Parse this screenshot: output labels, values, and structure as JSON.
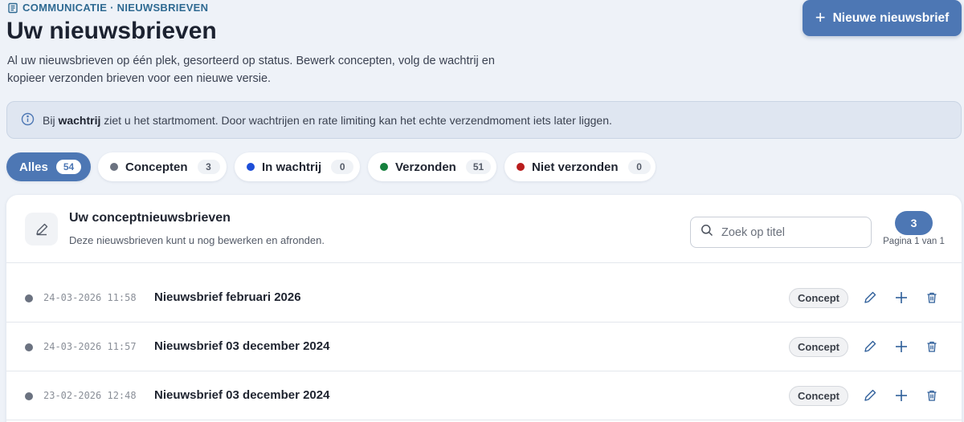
{
  "header": {
    "breadcrumb": "COMMUNICATIE · NIEUWSBRIEVEN",
    "title": "Uw nieuwsbrieven",
    "description": "Al uw nieuwsbrieven op één plek, gesorteerd op status. Bewerk concepten, volg de wachtrij en kopieer verzonden brieven voor een nieuwe versie.",
    "new_button_label": "Nieuwe nieuwsbrief"
  },
  "info": {
    "prefix": "Bij ",
    "bold": "wachtrij",
    "suffix": " ziet u het startmoment. Door wachtrijen en rate limiting kan het echte verzendmoment iets later liggen."
  },
  "filters": [
    {
      "label": "Alles",
      "count": "54",
      "active": true,
      "color": ""
    },
    {
      "label": "Concepten",
      "count": "3",
      "active": false,
      "color": "#6b7280"
    },
    {
      "label": "In wachtrij",
      "count": "0",
      "active": false,
      "color": "#1d4ed8"
    },
    {
      "label": "Verzonden",
      "count": "51",
      "active": false,
      "color": "#15803d"
    },
    {
      "label": "Niet verzonden",
      "count": "0",
      "active": false,
      "color": "#b91c1c"
    }
  ],
  "section": {
    "title": "Uw conceptnieuwsbrieven",
    "subtitle": "Deze nieuwsbrieven kunt u nog bewerken en afronden.",
    "search_placeholder": "Zoek op titel",
    "page_count": "3",
    "page_info": "Pagina 1 van 1"
  },
  "rows": [
    {
      "date": "24-03-2026 11:58",
      "title": "Nieuwsbrief februari 2026",
      "status": "Concept"
    },
    {
      "date": "24-03-2026 11:57",
      "title": "Nieuwsbrief 03 december 2024",
      "status": "Concept"
    },
    {
      "date": "23-02-2026 12:48",
      "title": "Nieuwsbrief 03 december 2024",
      "status": "Concept"
    }
  ],
  "colors": {
    "accent": "#4d77b4",
    "eyebrow": "#2f6a92",
    "background": "#eef2f8"
  }
}
